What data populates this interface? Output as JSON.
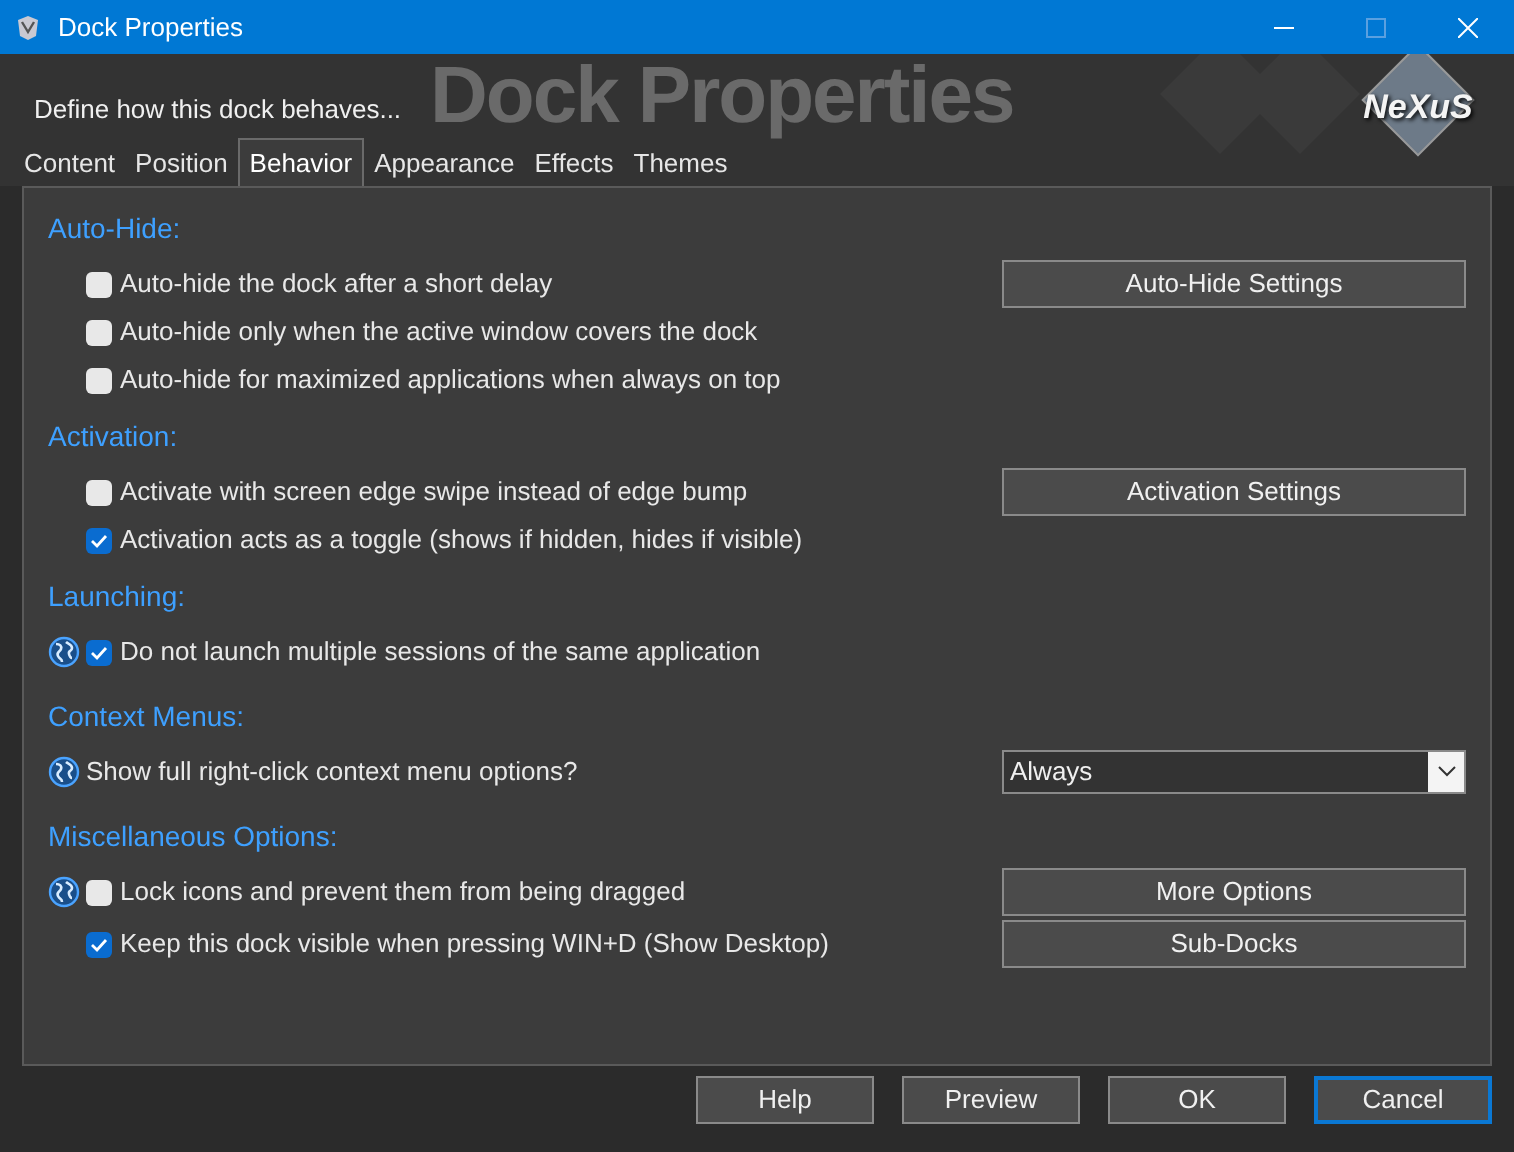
{
  "window": {
    "title": "Dock Properties"
  },
  "header": {
    "banner_text": "Dock Properties",
    "subtitle": "Define how this dock behaves...",
    "logo_text": "NeXuS"
  },
  "tabs": [
    {
      "label": "Content",
      "selected": false
    },
    {
      "label": "Position",
      "selected": false
    },
    {
      "label": "Behavior",
      "selected": true
    },
    {
      "label": "Appearance",
      "selected": false
    },
    {
      "label": "Effects",
      "selected": false
    },
    {
      "label": "Themes",
      "selected": false
    }
  ],
  "sections": [
    {
      "title": "Auto-Hide:",
      "rows": [
        {
          "kind": "checkbox",
          "label": "Auto-hide the dock after a short delay",
          "checked": false,
          "globe": false,
          "side": {
            "kind": "button",
            "label": "Auto-Hide Settings"
          }
        },
        {
          "kind": "checkbox",
          "label": "Auto-hide only when the active window covers the dock",
          "checked": false,
          "globe": false
        },
        {
          "kind": "checkbox",
          "label": "Auto-hide for maximized applications when always on top",
          "checked": false,
          "globe": false
        }
      ]
    },
    {
      "title": "Activation:",
      "rows": [
        {
          "kind": "checkbox",
          "label": "Activate with screen edge swipe instead of edge bump",
          "checked": false,
          "globe": false,
          "side": {
            "kind": "button",
            "label": "Activation Settings"
          }
        },
        {
          "kind": "checkbox",
          "label": "Activation acts as a toggle (shows if hidden, hides if visible)",
          "checked": true,
          "globe": false
        }
      ]
    },
    {
      "title": "Launching:",
      "rows": [
        {
          "kind": "checkbox",
          "label": "Do not launch multiple sessions of the same application",
          "checked": true,
          "globe": true
        }
      ]
    },
    {
      "title": "Context Menus:",
      "rows": [
        {
          "kind": "label",
          "label": "Show full right-click context menu options?",
          "globe": true,
          "side": {
            "kind": "select",
            "value": "Always"
          }
        }
      ]
    },
    {
      "title": "Miscellaneous Options:",
      "rows": [
        {
          "kind": "checkbox",
          "label": "Lock icons and prevent them from being dragged",
          "checked": false,
          "globe": true,
          "side": {
            "kind": "button",
            "label": "More Options"
          }
        },
        {
          "kind": "checkbox",
          "label": "Keep this dock visible when pressing WIN+D (Show Desktop)",
          "checked": true,
          "globe": false,
          "side": {
            "kind": "button",
            "label": "Sub-Docks"
          }
        }
      ]
    }
  ],
  "buttons": [
    {
      "label": "Help",
      "default": false
    },
    {
      "label": "Preview",
      "default": false
    },
    {
      "label": "OK",
      "default": false
    },
    {
      "label": "Cancel",
      "default": true
    }
  ]
}
